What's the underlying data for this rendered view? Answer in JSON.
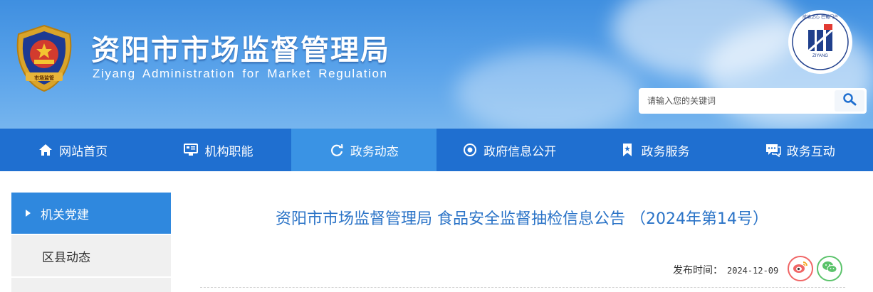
{
  "header": {
    "title_cn": "资阳市市场监督管理局",
    "title_en": "Ziyang Administration for Market Regulation",
    "emblem_text": "市场监管",
    "seal_text": "成渝之心 巴蜀门户",
    "seal_text_en": "ZIYANG",
    "search_placeholder": "请输入您的关键词"
  },
  "nav": [
    {
      "label": "网站首页",
      "icon": "home-icon"
    },
    {
      "label": "机构职能",
      "icon": "monitor-icon"
    },
    {
      "label": "政务动态",
      "icon": "refresh-icon",
      "active": true
    },
    {
      "label": "政府信息公开",
      "icon": "circle-target-icon"
    },
    {
      "label": "政务服务",
      "icon": "bookmark-icon"
    },
    {
      "label": "政务互动",
      "icon": "chat-icon"
    }
  ],
  "sidebar": {
    "items": [
      {
        "label": "机关党建",
        "active": true
      },
      {
        "label": "区县动态",
        "active": false
      }
    ]
  },
  "article": {
    "title": "资阳市市场监督管理局 食品安全监督抽检信息公告 （2024年第14号）",
    "pub_label": "发布时间：",
    "pub_date": "2024-12-09"
  },
  "colors": {
    "nav_bg": "#1f6fd0",
    "nav_active": "#3a93e4",
    "title_blue": "#2a73c7",
    "sidebar_active": "#2f88de",
    "weibo": "#f06565",
    "wechat": "#5bc36b"
  }
}
